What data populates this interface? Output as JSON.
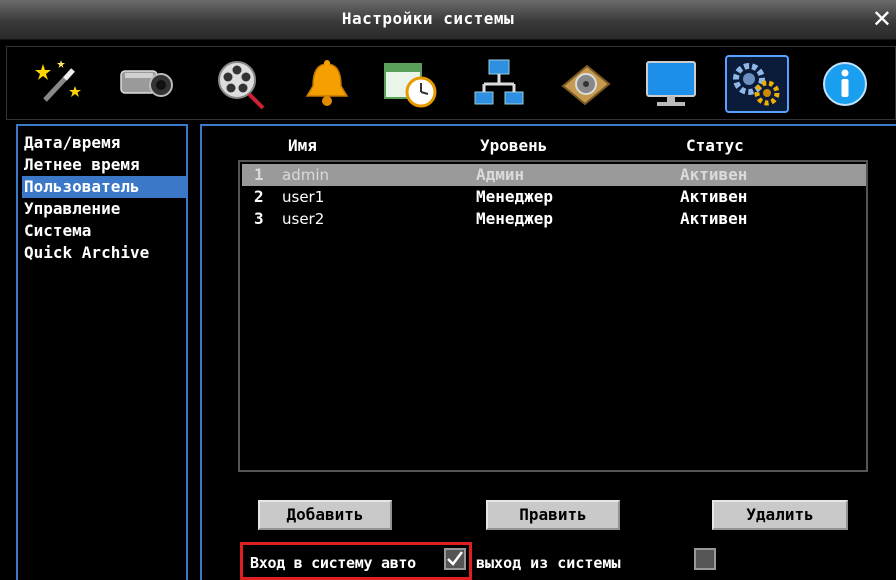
{
  "window": {
    "title": "Настройки системы",
    "close_glyph": "✕"
  },
  "toolbar": {
    "icons": [
      {
        "name": "magic-wand-icon"
      },
      {
        "name": "camera-icon"
      },
      {
        "name": "film-reel-icon"
      },
      {
        "name": "alarm-bell-icon"
      },
      {
        "name": "schedule-clock-icon"
      },
      {
        "name": "network-icon"
      },
      {
        "name": "hard-disk-icon"
      },
      {
        "name": "monitor-icon"
      },
      {
        "name": "system-settings-gears-icon",
        "active": true
      },
      {
        "name": "info-icon"
      }
    ]
  },
  "sidebar": {
    "items": [
      {
        "label": "Дата/время"
      },
      {
        "label": "Летнее время"
      },
      {
        "label": "Пользователь",
        "selected": true
      },
      {
        "label": "Управление"
      },
      {
        "label": "Система"
      },
      {
        "label": "Quick Archive"
      }
    ]
  },
  "users_table": {
    "headers": {
      "name": "Имя",
      "level": "Уровень",
      "status": "Статус"
    },
    "rows": [
      {
        "num": "1",
        "name": "admin",
        "level": "Админ",
        "status": "Активен",
        "selected": true
      },
      {
        "num": "2",
        "name": "user1",
        "level": "Менеджер",
        "status": "Активен"
      },
      {
        "num": "3",
        "name": "user2",
        "level": "Менеджер",
        "status": "Активен"
      }
    ]
  },
  "actions": {
    "add": "Добавить",
    "edit": "Править",
    "delete": "Удалить"
  },
  "options": {
    "login_auto_label": "Вход в систему авто",
    "login_auto_checked": true,
    "logout_label": "выход из системы",
    "logout_checked": false
  },
  "colors": {
    "accent_blue": "#3b78c8",
    "highlight_red": "#e02020"
  }
}
